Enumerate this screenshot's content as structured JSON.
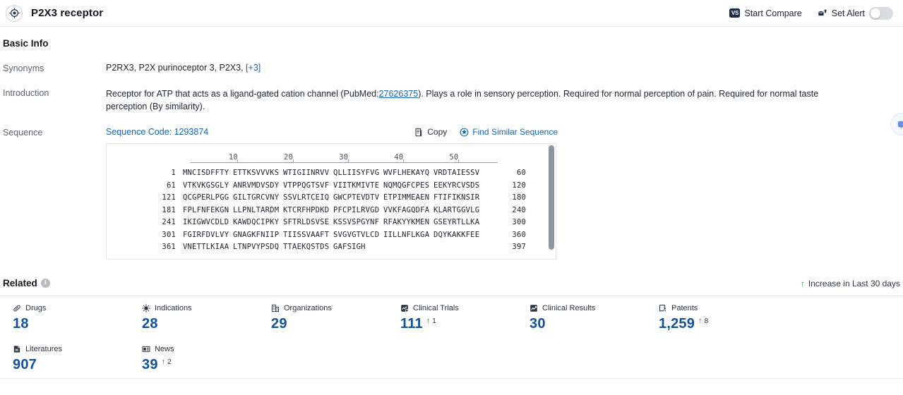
{
  "header": {
    "logo_icon": "target-circle-icon",
    "title": "P2X3 receptor",
    "start_compare": "Start Compare",
    "vs_badge": "VS",
    "set_alert": "Set Alert",
    "alert_toggle_state": "off"
  },
  "basic_info": {
    "section_title": "Basic Info",
    "synonyms_label": "Synonyms",
    "synonyms_text": "P2RX3,  P2X purinoceptor 3,  P2X3,",
    "synonyms_more": "[+3]",
    "introduction_label": "Introduction",
    "introduction_pre": "Receptor for ATP that acts as a ligand-gated cation channel (PubMed:",
    "introduction_link": "27626375",
    "introduction_post": "). Plays a role in sensory perception. Required for normal perception of pain. Required for normal taste perception (By similarity).",
    "sequence_label": "Sequence",
    "sequence_code": "Sequence Code: 1293874",
    "copy_label": "Copy",
    "find_similar_label": "Find Similar Sequence"
  },
  "sequence": {
    "ruler_ticks": [
      10,
      20,
      30,
      40,
      50
    ],
    "lines": [
      {
        "start": "1",
        "chunks": [
          "MNCISDFFTY",
          "ETTKSVVVKS",
          "WTIGIINRVV",
          "QLLIISYFVG",
          "WVFLHEKAYQ",
          "VRDTAIESSV"
        ],
        "end": "60"
      },
      {
        "start": "61",
        "chunks": [
          "VTKVKGSGLY",
          "ANRVMDVSDY",
          "VTPPQGTSVF",
          "VIITKMIVTE",
          "NQMQGFCPES",
          "EEKYRCVSDS"
        ],
        "end": "120"
      },
      {
        "start": "121",
        "chunks": [
          "QCGPERLPGG",
          "GILTGRCVNY",
          "SSVLRTCEIQ",
          "GWCPTEVDTV",
          "ETPIMMEAEN",
          "FTIFIKNSIR"
        ],
        "end": "180"
      },
      {
        "start": "181",
        "chunks": [
          "FPLFNFEKGN",
          "LLPNLTARDM",
          "KTCRFHPDKD",
          "PFCPILRVGD",
          "VVKFAGQDFA",
          "KLARTGGVLG"
        ],
        "end": "240"
      },
      {
        "start": "241",
        "chunks": [
          "IKIGWVCDLD",
          "KAWDQCIPKY",
          "SFTRLDSVSE",
          "KSSVSPGYNF",
          "RFAKYYKMEN",
          "GSEYRTLLKA"
        ],
        "end": "300"
      },
      {
        "start": "301",
        "chunks": [
          "FGIRFDVLVY",
          "GNAGKFNIIP",
          "TIISSVAAFT",
          "SVGVGTVLCD",
          "IILLNFLKGA",
          "DQYKAKKFEE"
        ],
        "end": "360"
      },
      {
        "start": "361",
        "chunks": [
          "VNETTLKIAA",
          "LTNPVYPSDQ",
          "TTAEKQSTDS",
          "GAFSIGH"
        ],
        "end": "397"
      }
    ]
  },
  "related": {
    "title": "Related",
    "info_icon": "info-icon",
    "legend_label": "Increase in Last 30 days",
    "cards": [
      {
        "icon": "pill-icon",
        "label": "Drugs",
        "value": "18",
        "delta": null
      },
      {
        "icon": "virus-icon",
        "label": "Indications",
        "value": "28",
        "delta": null
      },
      {
        "icon": "building-icon",
        "label": "Organizations",
        "value": "29",
        "delta": null
      },
      {
        "icon": "clinical-trial-icon",
        "label": "Clinical Trials",
        "value": "111",
        "delta": "1"
      },
      {
        "icon": "clinical-result-icon",
        "label": "Clinical Results",
        "value": "30",
        "delta": null
      },
      {
        "icon": "patent-icon",
        "label": "Patents",
        "value": "1,259",
        "delta": "8"
      },
      {
        "icon": "book-icon",
        "label": "Literatures",
        "value": "907",
        "delta": null
      },
      {
        "icon": "news-icon",
        "label": "News",
        "value": "39",
        "delta": "2"
      }
    ]
  },
  "edge_fab": {
    "icon": "chat-bubble-icon"
  },
  "colors": {
    "accent_blue": "#1565c0",
    "value_blue": "#11519e",
    "increase_green": "#2e7d32",
    "label_gray": "#5b6470"
  }
}
